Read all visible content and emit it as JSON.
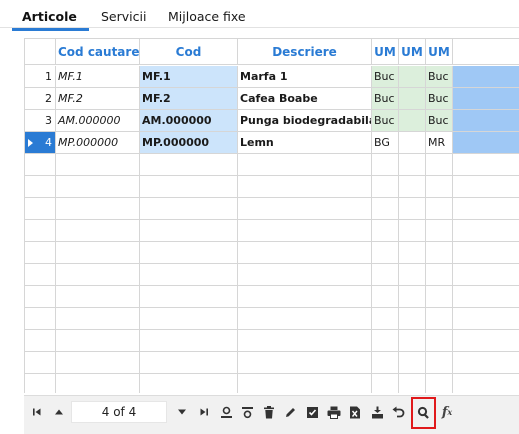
{
  "tabs": [
    {
      "label": "Articole",
      "active": true
    },
    {
      "label": "Servicii",
      "active": false
    },
    {
      "label": "Mijloace fixe",
      "active": false
    }
  ],
  "grid": {
    "columns": [
      {
        "label": ""
      },
      {
        "label": "Cod cautare"
      },
      {
        "label": "Cod"
      },
      {
        "label": "Descriere"
      },
      {
        "label": "UM"
      },
      {
        "label": "UM"
      },
      {
        "label": "UM"
      },
      {
        "label": ""
      }
    ],
    "rows": [
      {
        "num": "1",
        "cod_cautare": "MF.1",
        "cod": "MF.1",
        "descriere": "Marfa 1",
        "um1": "Buc",
        "um2": "",
        "um3": "Buc"
      },
      {
        "num": "2",
        "cod_cautare": "MF.2",
        "cod": "MF.2",
        "descriere": "Cafea Boabe",
        "um1": "Buc",
        "um2": "",
        "um3": "Buc"
      },
      {
        "num": "3",
        "cod_cautare": "AM.000000",
        "cod": "AM.000000",
        "descriere": "Punga biodegradabila",
        "um1": "Buc",
        "um2": "",
        "um3": "Buc"
      },
      {
        "num": "4",
        "cod_cautare": "MP.000000",
        "cod": "MP.000000",
        "descriere": "Lemn",
        "um1": "BG",
        "um2": "",
        "um3": "MR"
      }
    ]
  },
  "toolbar": {
    "pager_text": "4 of 4",
    "icons": [
      "first-page-icon",
      "previous-page-icon",
      "next-page-icon",
      "last-page-icon",
      "add-record-icon",
      "insert-row-icon",
      "delete-icon",
      "edit-icon",
      "checklist-icon",
      "print-icon",
      "export-excel-icon",
      "import-icon",
      "undo-icon",
      "search-icon",
      "formula-icon"
    ],
    "highlight_color": "#e0191b"
  },
  "colors": {
    "accent": "#2a7bd4",
    "cod_column_bg": "#cce4fb",
    "um_column_bg": "#dcefdc",
    "extra_column_bg": "#9fc8f5"
  }
}
